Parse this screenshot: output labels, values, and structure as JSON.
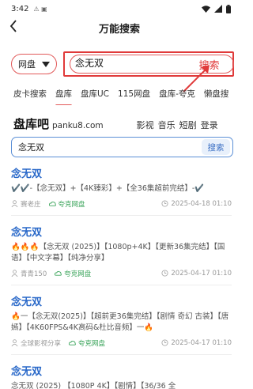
{
  "status": {
    "time": "3:42",
    "left_icons": "⚠ ▣"
  },
  "header": {
    "title": "万能搜索"
  },
  "search": {
    "scope": "网盘",
    "query": "念无双",
    "button": "搜索"
  },
  "tabs": [
    "皮卡搜索",
    "盘库",
    "盘库UC",
    "115网盘",
    "盘库-夸克",
    "懒盘搜"
  ],
  "site": {
    "brand": "盘库吧",
    "domain": "panku8.com",
    "nav": [
      "影视",
      "音乐",
      "短剧",
      "登录"
    ],
    "search_query": "念无双",
    "search_button": "搜索"
  },
  "results": [
    {
      "title": "念无双",
      "desc": "✔️✔️-【念无双】+【4K臻彩】+【全36集超前完结】-✔️",
      "user": "赛老庄",
      "cloud": "夸克网盘",
      "date": "2025-04-18 01:10"
    },
    {
      "title": "念无双",
      "desc": "🔥🔥🔥【念无双 (2025)】【1080p+4K】【更新36集完结】【国语】【中文字幕】【纯净分享】",
      "user": "青青150",
      "cloud": "夸克网盘",
      "date": "2025-04-17 01:10"
    },
    {
      "title": "念无双",
      "desc": "🔥一【念无双(2025)】【超前更36集完结】【剧情 奇幻 古装】【唐嫣】【4K60FPS&4K高码&杜比音频】一🔥",
      "user": "全球影视分享",
      "cloud": "夸克网盘",
      "date": "2025-04-17 01:10"
    },
    {
      "title": "念无双",
      "desc": "念无双 (2025) 【1080P 4K】【剧情】【36/36 全",
      "user": "",
      "cloud": "",
      "date": ""
    }
  ]
}
